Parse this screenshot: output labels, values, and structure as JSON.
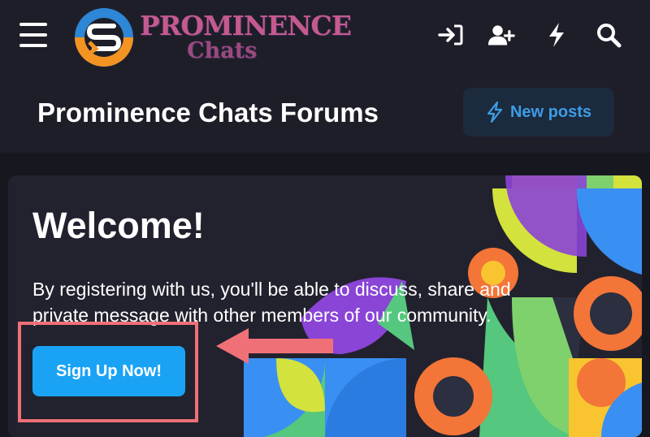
{
  "header": {
    "logo_line1": "PROMINENCE",
    "logo_line2": "Chats",
    "icons": [
      "login-icon",
      "register-icon",
      "whats-new-icon",
      "search-icon"
    ]
  },
  "title_bar": {
    "title": "Prominence Chats Forums",
    "new_posts_label": "New posts"
  },
  "welcome": {
    "heading": "Welcome!",
    "text": "By registering with us, you'll be able to discuss, share and private message with other members of our community.",
    "signup_label": "Sign Up Now!"
  },
  "colors": {
    "background": "#17171f",
    "bar": "#1e1e29",
    "card": "#22222e",
    "accent_blue": "#1aa3f5",
    "highlight": "#f07078",
    "logo_blue": "#2e86d6",
    "logo_orange": "#f39322"
  }
}
